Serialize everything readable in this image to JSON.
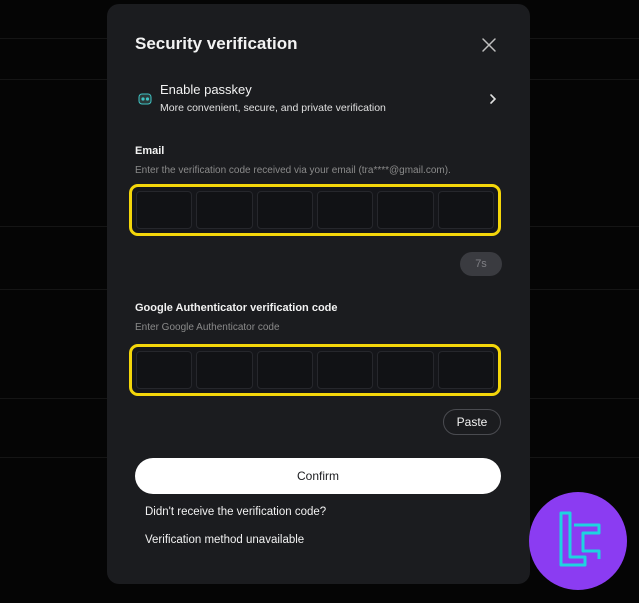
{
  "dialog": {
    "title": "Security verification",
    "close_icon": "close-icon"
  },
  "passkey": {
    "title": "Enable passkey",
    "subtitle": "More convenient, secure, and private verification",
    "icon": "passkey-icon",
    "chevron_icon": "chevron-right-icon"
  },
  "email": {
    "label": "Email",
    "hint": "Enter the verification code received via your email (tra****@gmail.com).",
    "digits": [
      "",
      "",
      "",
      "",
      "",
      ""
    ],
    "resend_timer": "7s"
  },
  "authenticator": {
    "label": "Google Authenticator verification code",
    "hint": "Enter Google Authenticator code",
    "digits": [
      "",
      "",
      "",
      "",
      "",
      ""
    ],
    "paste_label": "Paste"
  },
  "actions": {
    "confirm_label": "Confirm",
    "no_code_link": "Didn't receive the verification code?",
    "method_unavailable_link": "Verification method unavailable"
  },
  "colors": {
    "accent_outline": "#f4d60a",
    "modal_bg": "#1b1c1f",
    "logo_purple": "#8b3cf2",
    "logo_cyan": "#1ed3e0"
  }
}
